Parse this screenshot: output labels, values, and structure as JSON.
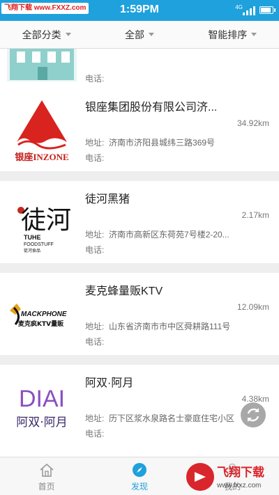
{
  "status_bar": {
    "watermark": "飞翔下载 www.FXXZ.com",
    "time": "1:59PM",
    "network": "4G"
  },
  "filters": [
    {
      "label": "全部分类"
    },
    {
      "label": "全部"
    },
    {
      "label": "智能排序"
    }
  ],
  "partial_item": {
    "tel_label": "电话:"
  },
  "items": [
    {
      "name": "银座集团股份有限公司济...",
      "distance": "34.92km",
      "address_label": "地址:",
      "address": "济南市济阳县城纬三路369号",
      "tel_label": "电话:",
      "logo_text": "银座INZONE"
    },
    {
      "name": "徒河黑猪",
      "distance": "2.17km",
      "address_label": "地址:",
      "address": "济南市高新区东荷苑7号楼2-20...",
      "tel_label": "电话:",
      "logo_text": "徒河",
      "logo_sub1": "TUHE",
      "logo_sub2": "FOODSTUFF",
      "logo_sub3": "徒河食品"
    },
    {
      "name": "麦克蜂量贩KTV",
      "distance": "12.09km",
      "address_label": "地址:",
      "address": "山东省济南市市中区舜耕路111号",
      "tel_label": "电话:",
      "logo_text": "麦克疯KTV量販",
      "logo_sub1": "MACKPHONE"
    },
    {
      "name": "阿双·阿月",
      "distance": "4.38km",
      "address_label": "地址:",
      "address": "历下区浆水泉路名士豪庭住宅小区",
      "tel_label": "电话:",
      "logo_text": "DIAI",
      "logo_sub1": "阿双·阿月"
    }
  ],
  "tabs": [
    {
      "label": "首页",
      "icon": "home-icon"
    },
    {
      "label": "发现",
      "icon": "compass-icon"
    },
    {
      "label": "我的",
      "icon": "user-icon"
    }
  ],
  "brand_watermark": {
    "text": "飞翔下载",
    "url": "www.fxxz.com"
  },
  "colors": {
    "accent": "#1ea1dc",
    "background": "#eeeeee"
  }
}
